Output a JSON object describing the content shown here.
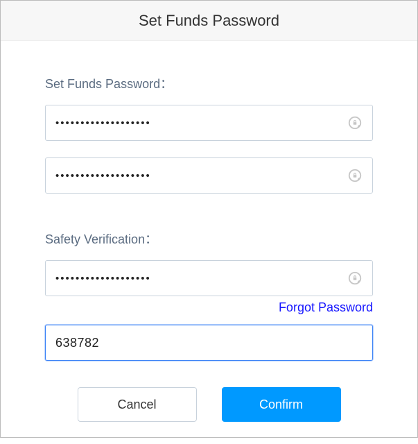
{
  "dialog": {
    "title": "Set Funds Password"
  },
  "sections": {
    "funds": {
      "label": "Set Funds Password：",
      "password1": "•••••••••••••••••••",
      "password2": "•••••••••••••••••••"
    },
    "safety": {
      "label": "Safety Verification：",
      "password": "•••••••••••••••••••",
      "forgot_label": "Forgot Password",
      "code": "638782"
    }
  },
  "buttons": {
    "cancel": "Cancel",
    "confirm": "Confirm"
  }
}
